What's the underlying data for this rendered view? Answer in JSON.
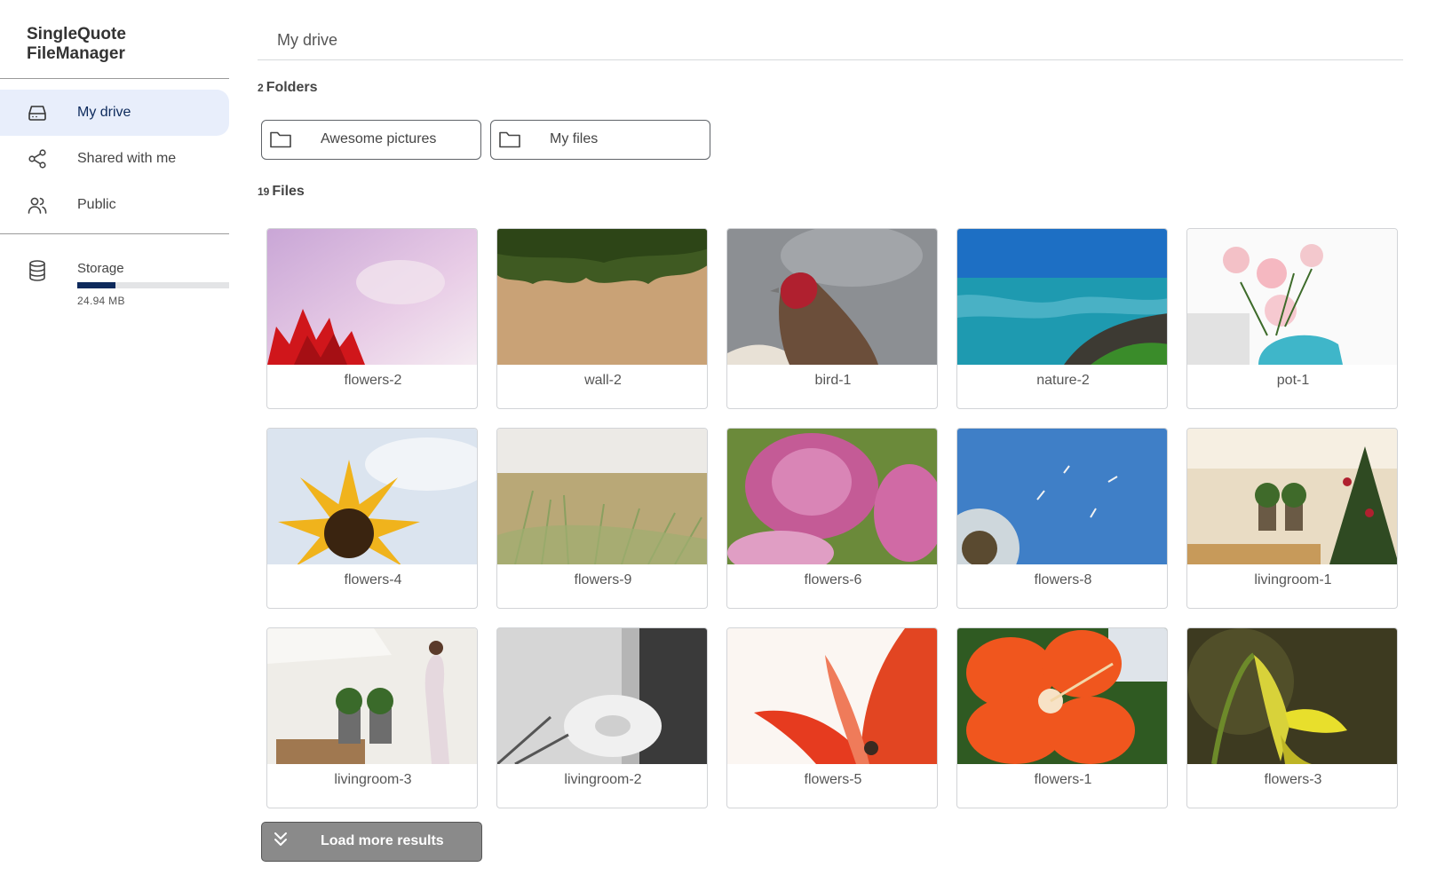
{
  "app": {
    "title": "SingleQuote FileManager"
  },
  "sidebar": {
    "items": [
      {
        "label": "My drive",
        "icon": "drive-icon"
      },
      {
        "label": "Shared with me",
        "icon": "share-icon"
      },
      {
        "label": "Public",
        "icon": "users-icon"
      }
    ],
    "storage": {
      "label": "Storage",
      "used": "24.94 MB",
      "used_fraction": 0.25,
      "icon": "database-icon"
    }
  },
  "breadcrumb": "My drive",
  "folders": {
    "count": "2",
    "heading": "Folders",
    "items": [
      {
        "name": "Awesome pictures"
      },
      {
        "name": "My files"
      }
    ]
  },
  "files": {
    "count": "19",
    "heading": "Files",
    "items": [
      {
        "name": "flowers-2"
      },
      {
        "name": "wall-2"
      },
      {
        "name": "bird-1"
      },
      {
        "name": "nature-2"
      },
      {
        "name": "pot-1"
      },
      {
        "name": "flowers-4"
      },
      {
        "name": "flowers-9"
      },
      {
        "name": "flowers-6"
      },
      {
        "name": "flowers-8"
      },
      {
        "name": "livingroom-1"
      },
      {
        "name": "livingroom-3"
      },
      {
        "name": "livingroom-2"
      },
      {
        "name": "flowers-5"
      },
      {
        "name": "flowers-1"
      },
      {
        "name": "flowers-3"
      }
    ]
  },
  "load_more": {
    "label": "Load more results",
    "icon": "chevrons-down-icon"
  },
  "colors": {
    "accent": "#0d2a5c",
    "active_bg": "#e8eefb",
    "button_bg": "#8a8a8a"
  }
}
